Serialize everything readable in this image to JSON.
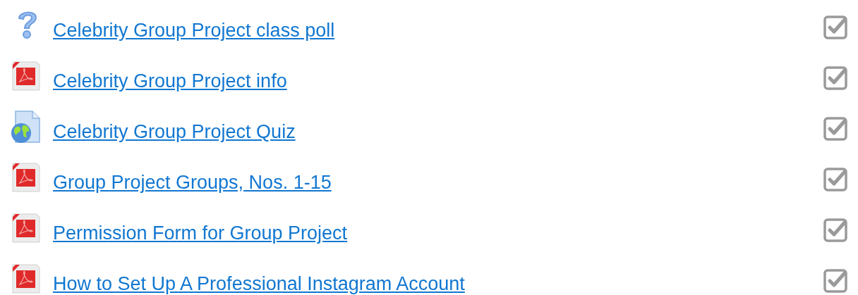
{
  "activities": [
    {
      "kind": "question",
      "title": "Celebrity Group Project class poll",
      "checked": true
    },
    {
      "kind": "pdf",
      "title": "Celebrity Group Project info",
      "checked": true
    },
    {
      "kind": "web",
      "title": "Celebrity Group Project Quiz",
      "checked": true
    },
    {
      "kind": "pdf",
      "title": "Group Project Groups, Nos. 1-15",
      "checked": true
    },
    {
      "kind": "pdf",
      "title": "Permission Form for Group Project",
      "checked": true
    },
    {
      "kind": "pdf",
      "title": "How to Set Up A Professional Instagram Account",
      "checked": true
    }
  ]
}
